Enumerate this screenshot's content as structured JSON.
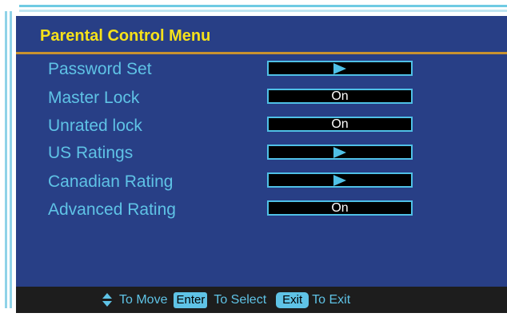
{
  "menu": {
    "title": "Parental Control Menu",
    "items": [
      {
        "label": "Password Set",
        "value": "",
        "type": "arrow"
      },
      {
        "label": "Master Lock",
        "value": "On",
        "type": "value"
      },
      {
        "label": "Unrated lock",
        "value": "On",
        "type": "value"
      },
      {
        "label": "US Ratings",
        "value": "",
        "type": "arrow"
      },
      {
        "label": "Canadian Rating",
        "value": "",
        "type": "arrow"
      },
      {
        "label": "Advanced Rating",
        "value": "On",
        "type": "value"
      }
    ]
  },
  "help": {
    "move_text": "To Move",
    "enter_key": "Enter",
    "select_text": "To Select",
    "exit_key": "Exit",
    "exit_text": "To Exit",
    "move_icon": "up-down-arrows-icon"
  },
  "colors": {
    "background": "#283f86",
    "title": "#f5e11a",
    "accent": "#5fc3e6",
    "divider": "#c8922f",
    "help_bar": "#1d1d1d"
  }
}
